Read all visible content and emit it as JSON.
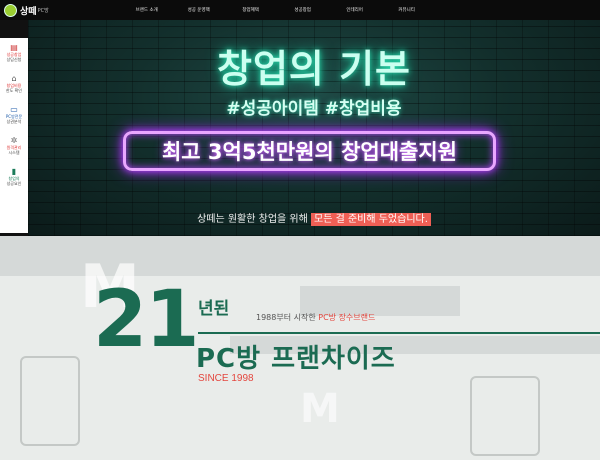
{
  "logo": {
    "badge": "썡",
    "name": "상떼",
    "sub": "PC방"
  },
  "nav": [
    {
      "label": "브랜드 소개"
    },
    {
      "label": "성공 운영팩"
    },
    {
      "label": "창업혜택"
    },
    {
      "label": "성공창업"
    },
    {
      "label": "인테리어"
    },
    {
      "label": "커뮤니티"
    }
  ],
  "sidebar": [
    {
      "icon": "doc-icon",
      "glyph": "▤",
      "line1": "성공창업",
      "line2": "상담신청",
      "tone": "red"
    },
    {
      "icon": "store-icon",
      "glyph": "⌂",
      "line1": "창업비용",
      "line2": "한도 확인",
      "tone": "red"
    },
    {
      "icon": "monitor-icon",
      "glyph": "▭",
      "line1": "PC방전문",
      "line2": "상권분석",
      "tone": "blue"
    },
    {
      "icon": "gear-icon",
      "glyph": "✲",
      "line1": "원격관리",
      "line2": "시스템",
      "tone": "red"
    },
    {
      "icon": "chart-icon",
      "glyph": "▮",
      "line1": "창업의",
      "line2": "성공요인",
      "tone": "green"
    }
  ],
  "hero": {
    "title": "창업의 기본",
    "tags": "#성공아이템  #창업비용",
    "neon": "최고 3억5천만원의 창업대출지원",
    "sub_prefix": "상떼는 원활한 창업을 위해 ",
    "sub_highlight": "모든 걸 준비해 두었습니다."
  },
  "brand": {
    "number": "21",
    "years": "년된",
    "since_text": "1988부터 시작한 ",
    "since_red": "PC방 장수브랜드",
    "title": "PC방 프랜차이즈",
    "since": "SINCE 1998"
  },
  "colors": {
    "brand_green": "#1b6b52",
    "accent_red": "#e4463e",
    "neon_purple": "#b742ff",
    "neon_green": "#28e3b3"
  }
}
